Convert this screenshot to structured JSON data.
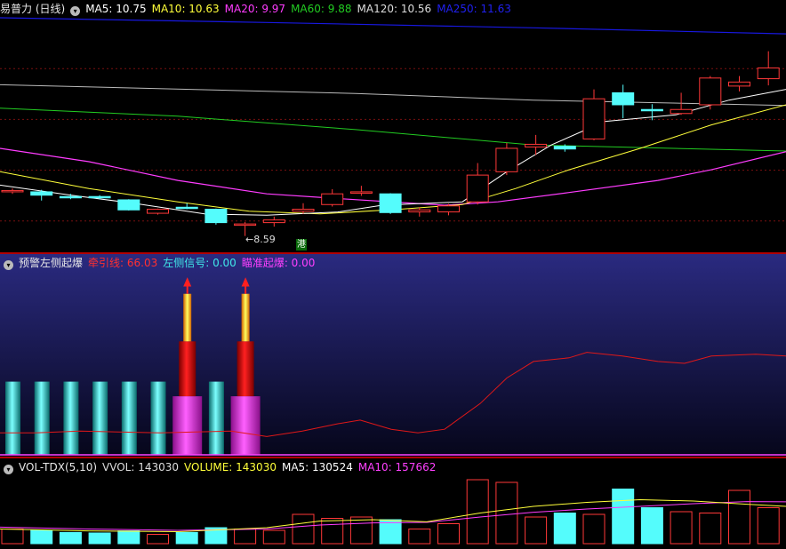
{
  "colors": {
    "up": "#ff3838",
    "down": "#54fcfc",
    "ma5": "#ffffff",
    "ma10": "#ffff3a",
    "ma20": "#ff3cff",
    "ma60": "#22cc22",
    "ma120": "#bbbbbb",
    "ma250": "#1818e0",
    "pull": "#e01818",
    "left": "#40e8e8",
    "aim": "#ff40ff",
    "grid": "#7a1010",
    "sep": "#b00000"
  },
  "price_pane": {
    "title": "易普力 (日线)",
    "menu_icon": "chevron-down-icon",
    "legend": [
      {
        "label": "MA5: 10.75",
        "color": "#ffffff"
      },
      {
        "label": "MA10: 10.63",
        "color": "#ffff3a"
      },
      {
        "label": "MA20: 9.97",
        "color": "#ff3cff"
      },
      {
        "label": "MA60: 9.88",
        "color": "#22cc22"
      },
      {
        "label": "MA120: 10.56",
        "color": "#dddddd"
      },
      {
        "label": "MA250: 11.63",
        "color": "#2020ee"
      }
    ],
    "min_label": "←8.59",
    "hk_badge": "港",
    "ylim": [
      8.4,
      11.85
    ],
    "candles": [
      [
        9.25,
        9.27,
        9.3,
        9.22
      ],
      [
        9.25,
        9.2,
        9.28,
        9.12
      ],
      [
        9.18,
        9.16,
        9.22,
        9.14
      ],
      [
        9.18,
        9.16,
        9.2,
        9.14
      ],
      [
        9.13,
        8.98,
        9.14,
        8.97
      ],
      [
        8.93,
        8.99,
        9.0,
        8.91
      ],
      [
        9.02,
        9.01,
        9.08,
        8.99
      ],
      [
        8.99,
        8.79,
        9.0,
        8.76
      ],
      [
        8.76,
        8.77,
        8.8,
        8.59
      ],
      [
        8.79,
        8.83,
        8.88,
        8.73
      ],
      [
        8.96,
        8.99,
        9.08,
        8.92
      ],
      [
        9.06,
        9.22,
        9.29,
        9.03
      ],
      [
        9.24,
        9.25,
        9.34,
        9.19
      ],
      [
        9.22,
        8.94,
        9.23,
        8.92
      ],
      [
        8.95,
        8.98,
        9.02,
        8.88
      ],
      [
        8.95,
        9.04,
        9.07,
        8.9
      ],
      [
        9.1,
        9.5,
        9.68,
        9.06
      ],
      [
        9.55,
        9.9,
        9.98,
        9.5
      ],
      [
        9.92,
        9.96,
        10.1,
        9.8
      ],
      [
        9.93,
        9.89,
        9.96,
        9.85
      ],
      [
        10.04,
        10.64,
        10.78,
        10.02
      ],
      [
        10.73,
        10.55,
        10.85,
        10.35
      ],
      [
        10.48,
        10.47,
        10.56,
        10.32
      ],
      [
        10.42,
        10.48,
        10.73,
        10.4
      ],
      [
        10.55,
        10.95,
        10.98,
        10.48
      ],
      [
        10.83,
        10.89,
        10.98,
        10.75
      ],
      [
        10.94,
        11.1,
        11.35,
        10.84
      ],
      [
        11.02,
        10.88,
        11.17,
        10.8
      ]
    ],
    "ma_lines": {
      "ma120": [
        [
          0,
          10.85
        ],
        [
          400,
          10.72
        ],
        [
          600,
          10.62
        ],
        [
          884,
          10.54
        ]
      ],
      "ma250": [
        [
          0,
          11.85
        ],
        [
          300,
          11.78
        ],
        [
          600,
          11.7
        ],
        [
          884,
          11.61
        ]
      ],
      "ma60": [
        [
          0,
          10.5
        ],
        [
          200,
          10.38
        ],
        [
          400,
          10.18
        ],
        [
          600,
          9.95
        ],
        [
          884,
          9.86
        ]
      ],
      "ma20": [
        [
          0,
          9.9
        ],
        [
          100,
          9.7
        ],
        [
          200,
          9.42
        ],
        [
          300,
          9.22
        ],
        [
          380,
          9.15
        ],
        [
          500,
          9.05
        ],
        [
          560,
          9.1
        ],
        [
          640,
          9.24
        ],
        [
          740,
          9.42
        ],
        [
          800,
          9.58
        ],
        [
          884,
          9.85
        ]
      ],
      "ma10": [
        [
          0,
          9.55
        ],
        [
          100,
          9.3
        ],
        [
          200,
          9.1
        ],
        [
          280,
          8.96
        ],
        [
          360,
          8.92
        ],
        [
          450,
          8.99
        ],
        [
          520,
          9.06
        ],
        [
          580,
          9.3
        ],
        [
          640,
          9.58
        ],
        [
          720,
          9.9
        ],
        [
          800,
          10.25
        ],
        [
          884,
          10.55
        ]
      ],
      "ma5": [
        [
          0,
          9.35
        ],
        [
          80,
          9.2
        ],
        [
          150,
          9.08
        ],
        [
          230,
          8.92
        ],
        [
          300,
          8.9
        ],
        [
          380,
          8.95
        ],
        [
          430,
          9.05
        ],
        [
          520,
          9.1
        ],
        [
          570,
          9.55
        ],
        [
          620,
          9.95
        ],
        [
          680,
          10.3
        ],
        [
          760,
          10.4
        ],
        [
          820,
          10.62
        ],
        [
          884,
          10.78
        ]
      ]
    }
  },
  "indicator_pane": {
    "title": "预警左侧起爆",
    "menu_icon": "chevron-down-icon",
    "legend": [
      {
        "label": "牵引线: 66.03",
        "color": "#ff3030"
      },
      {
        "label": "左侧信号: 0.00",
        "color": "#40e8e8"
      },
      {
        "label": "瞄准起爆: 0.00",
        "color": "#ff40ff"
      }
    ],
    "ylim": [
      0,
      100
    ],
    "cyan_bars": [
      0,
      1,
      2,
      3,
      4,
      5,
      7
    ],
    "signal_bars": [
      6,
      8
    ],
    "signal_icon": "up-arrow-icon",
    "pull_line": [
      [
        0,
        12
      ],
      [
        40,
        12
      ],
      [
        90,
        13
      ],
      [
        180,
        12
      ],
      [
        260,
        13
      ],
      [
        300,
        10
      ],
      [
        340,
        13
      ],
      [
        380,
        17
      ],
      [
        405,
        19
      ],
      [
        440,
        14
      ],
      [
        470,
        12
      ],
      [
        500,
        14
      ],
      [
        540,
        28
      ],
      [
        570,
        42
      ],
      [
        600,
        51
      ],
      [
        640,
        53
      ],
      [
        660,
        56
      ],
      [
        700,
        54
      ],
      [
        740,
        51
      ],
      [
        770,
        50
      ],
      [
        800,
        54
      ],
      [
        850,
        55
      ],
      [
        884,
        54
      ]
    ]
  },
  "volume_pane": {
    "title": "VOL-TDX(5,10)",
    "menu_icon": "chevron-down-icon",
    "legend": [
      {
        "label": "VVOL: 143030",
        "color": "#dddddd"
      },
      {
        "label": "VOLUME: 143030",
        "color": "#ffff3a"
      },
      {
        "label": "MA5: 130524",
        "color": "#ffffff"
      },
      {
        "label": "MA10: 157662",
        "color": "#ff40ff"
      }
    ],
    "ylim": [
      0,
      260000
    ],
    "volumes": [
      55000,
      50000,
      42000,
      40000,
      48000,
      35000,
      42000,
      60000,
      55000,
      50000,
      110000,
      95000,
      100000,
      90000,
      55000,
      75000,
      240000,
      230000,
      100000,
      115000,
      110000,
      205000,
      135000,
      120000,
      115000,
      200000,
      135000,
      135000
    ],
    "ma5_line": [
      [
        0,
        55000
      ],
      [
        100,
        48000
      ],
      [
        200,
        45000
      ],
      [
        300,
        60000
      ],
      [
        360,
        85000
      ],
      [
        420,
        90000
      ],
      [
        480,
        82000
      ],
      [
        540,
        115000
      ],
      [
        600,
        140000
      ],
      [
        660,
        155000
      ],
      [
        720,
        165000
      ],
      [
        780,
        160000
      ],
      [
        840,
        148000
      ],
      [
        884,
        140000
      ]
    ],
    "ma10_line": [
      [
        0,
        62000
      ],
      [
        100,
        55000
      ],
      [
        200,
        50000
      ],
      [
        300,
        55000
      ],
      [
        360,
        70000
      ],
      [
        420,
        78000
      ],
      [
        480,
        80000
      ],
      [
        540,
        100000
      ],
      [
        600,
        118000
      ],
      [
        660,
        130000
      ],
      [
        720,
        140000
      ],
      [
        780,
        150000
      ],
      [
        840,
        158000
      ],
      [
        884,
        157000
      ]
    ]
  }
}
